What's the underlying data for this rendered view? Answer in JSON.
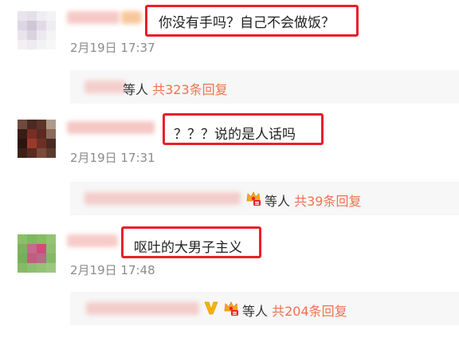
{
  "comments": [
    {
      "text": "你没有手吗？自己不会做饭？",
      "time": "2月19日 17:37",
      "reply": {
        "deng": "等人",
        "count": "共323条回复"
      }
    },
    {
      "text": "？？？说的是人话吗",
      "time": "2月19日 17:31",
      "reply": {
        "deng": "等人",
        "count": "共39条回复"
      }
    },
    {
      "text": "呕吐的大男子主义",
      "time": "2月19日 17:48",
      "reply": {
        "deng": "等人",
        "count": "共204条回复"
      }
    }
  ],
  "colors": {
    "highlight_border": "#e8202a",
    "reply_count": "#eb7350",
    "time": "#8b8b8b"
  },
  "icons": [
    "crown-badge-icon",
    "v-badge-icon"
  ]
}
